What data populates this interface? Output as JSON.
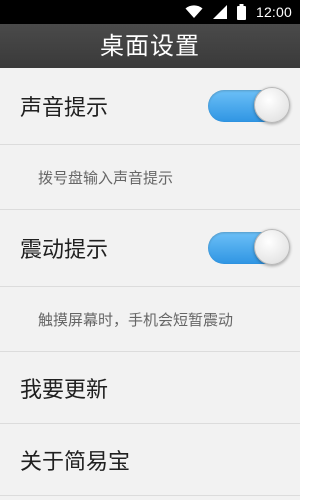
{
  "status_bar": {
    "time": "12:00",
    "icons": [
      "wifi-icon",
      "signal-icon",
      "battery-icon"
    ],
    "background": "#000000"
  },
  "header": {
    "title": "桌面设置",
    "background": "#404040"
  },
  "settings": {
    "sound_hint": {
      "label": "声音提示",
      "description": "拨号盘输入声音提示",
      "enabled": true
    },
    "vibration_hint": {
      "label": "震动提示",
      "description": "触摸屏幕时，手机会短暂震动",
      "enabled": true
    },
    "update": {
      "label": "我要更新"
    },
    "about": {
      "label": "关于简易宝"
    }
  },
  "colors": {
    "toggle_on": "#3aa2ea",
    "row_background": "#f2f2f2",
    "divider": "#dcdcdc"
  }
}
